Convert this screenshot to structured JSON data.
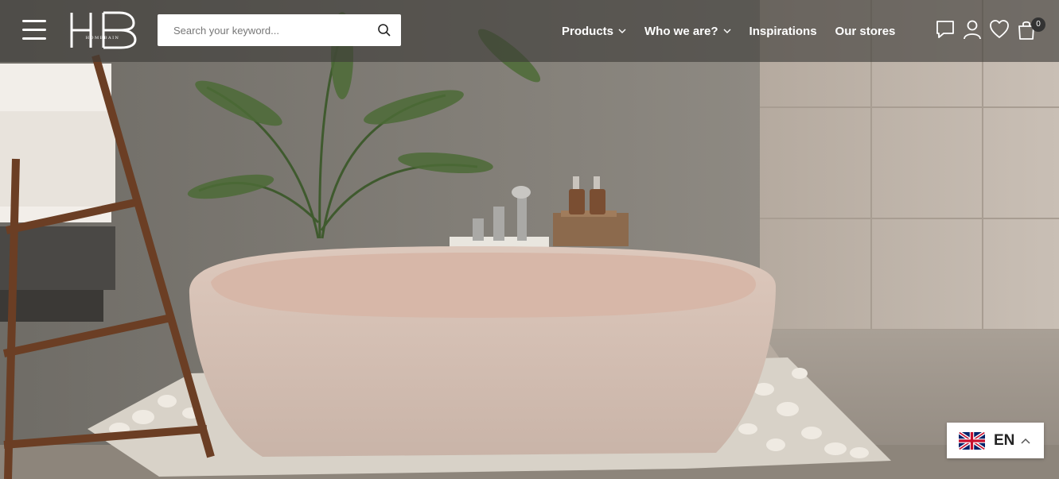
{
  "header": {
    "logo_text": "HOMEBAIN",
    "search": {
      "placeholder": "Search your keyword..."
    },
    "nav": [
      {
        "label": "Products",
        "has_dropdown": true
      },
      {
        "label": "Who we are?",
        "has_dropdown": true
      },
      {
        "label": "Inspirations",
        "has_dropdown": false
      },
      {
        "label": "Our stores",
        "has_dropdown": false
      }
    ],
    "icons": [
      "chat-icon",
      "user-icon",
      "heart-icon",
      "cart-icon"
    ],
    "cart_count": "0"
  },
  "language": {
    "code": "EN",
    "flag": "uk-flag-icon"
  },
  "colors": {
    "header_overlay": "#3c3a37",
    "white": "#ffffff",
    "badge": "#333333"
  }
}
